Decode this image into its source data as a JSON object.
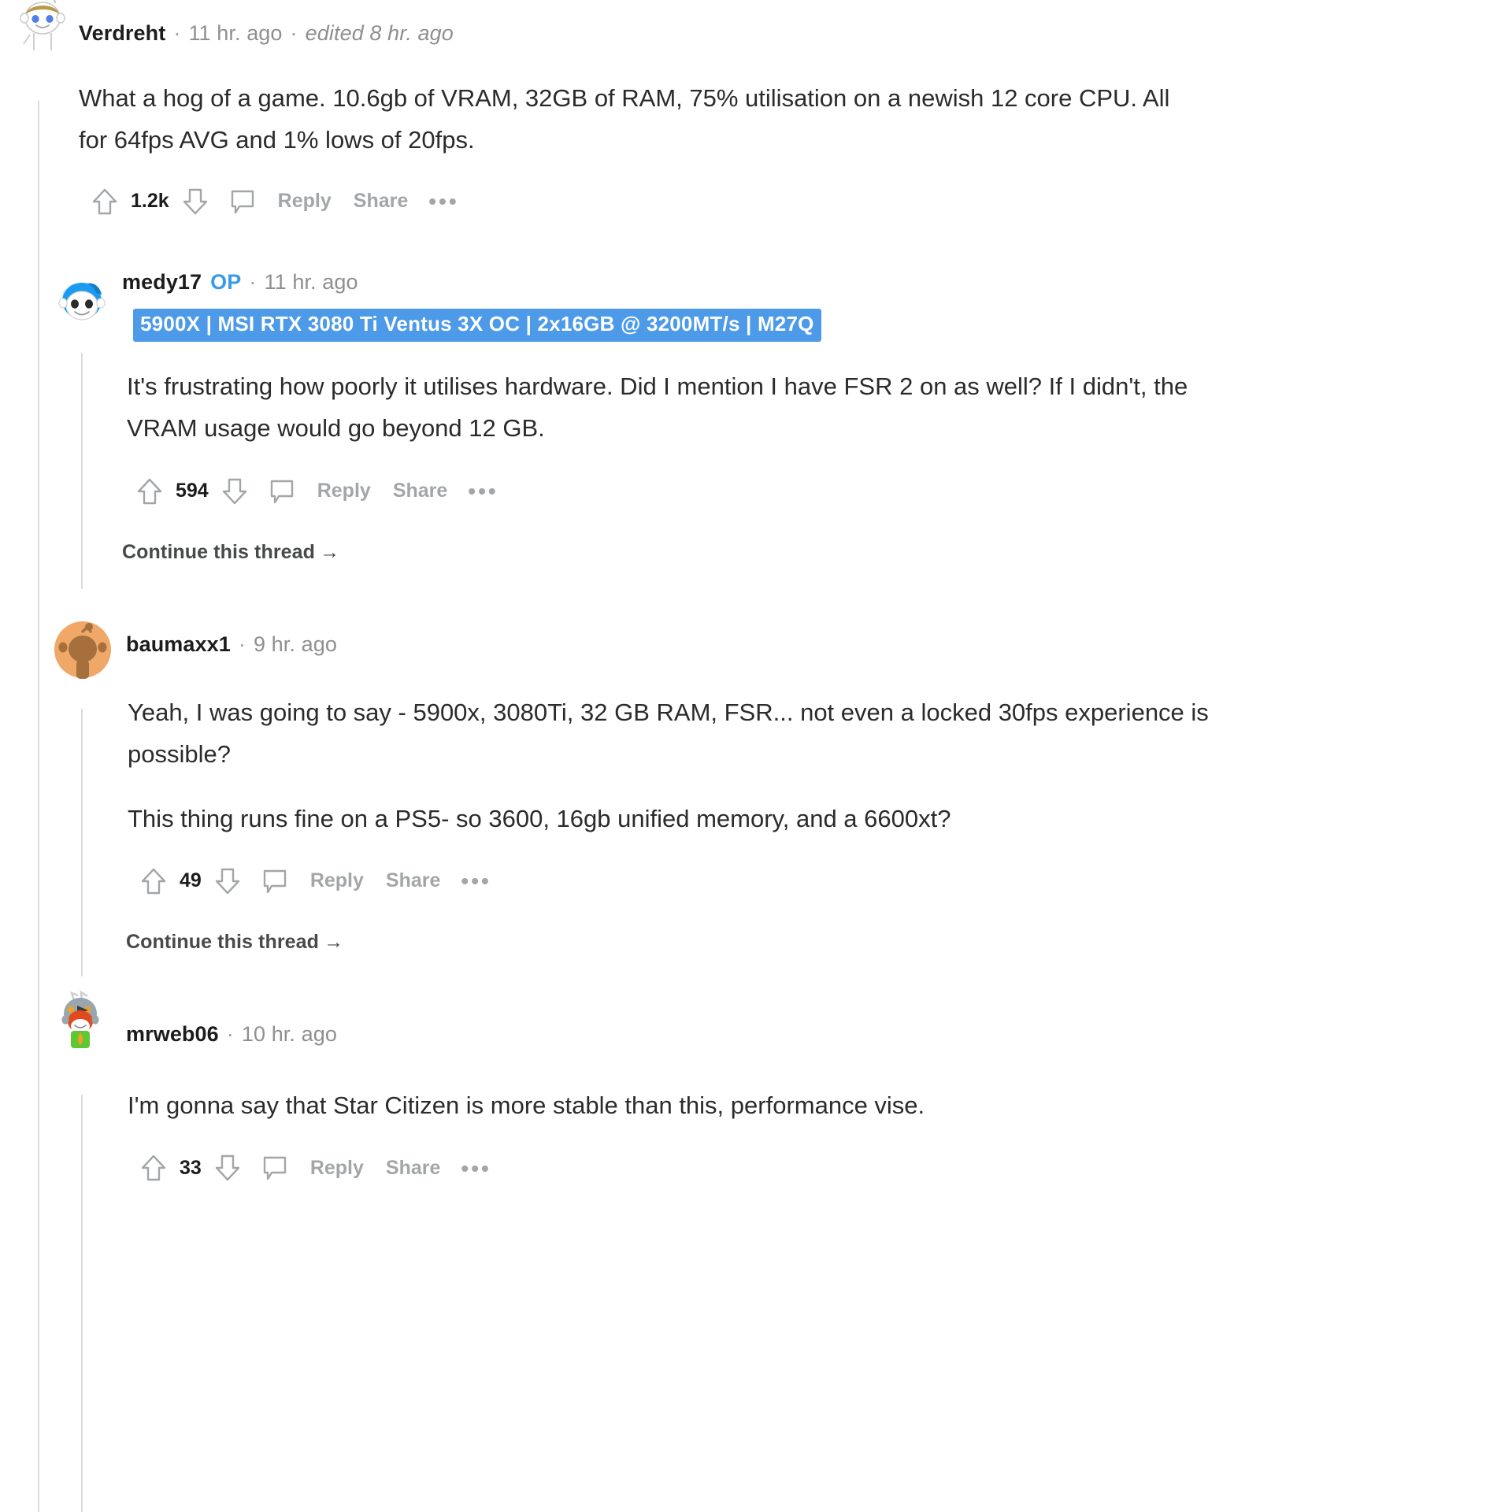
{
  "theme": {
    "accent_blue": "#4c9ae8",
    "op_blue": "#3a9ae8",
    "text": "#2b2b2b",
    "muted": "#8f8f8f",
    "action_grey": "#a3a6a8",
    "threadline": "#dcdcdc",
    "background": "#ffffff"
  },
  "comments": [
    {
      "id": "verdreht",
      "username": "Verdreht",
      "timestamp": "11 hr. ago",
      "edited": "edited 8 hr. ago",
      "separator": "·",
      "avatar_icon": "snoo-blonde-avatar",
      "paragraphs": [
        "What a hog of a game. 10.6gb of VRAM, 32GB of RAM, 75% utilisation on a newish 12 core CPU. All for 64fps AVG and 1% lows of 20fps."
      ],
      "score": "1.2k",
      "actions": {
        "upvote": "upvote-arrow",
        "downvote": "downvote-arrow",
        "comment": "comment-bubble",
        "reply": "Reply",
        "share": "Share",
        "more": "•••"
      }
    },
    {
      "id": "medy17",
      "username": "medy17",
      "op_badge": "OP",
      "timestamp": "11 hr. ago",
      "separator": "·",
      "avatar_icon": "snoo-blue-hair-avatar",
      "flair": "5900X | MSI RTX 3080 Ti Ventus 3X OC | 2x16GB @ 3200MT/s | M27Q",
      "paragraphs": [
        "It's frustrating how poorly it utilises hardware. Did I mention I have FSR 2 on as well? If I didn't, the VRAM usage would go beyond 12 GB."
      ],
      "score": "594",
      "actions": {
        "upvote": "upvote-arrow",
        "downvote": "downvote-arrow",
        "comment": "comment-bubble",
        "reply": "Reply",
        "share": "Share",
        "more": "•••"
      },
      "continue_label": "Continue this thread",
      "continue_arrow": "→"
    },
    {
      "id": "baumaxx1",
      "username": "baumaxx1",
      "timestamp": "9 hr. ago",
      "separator": "·",
      "avatar_icon": "snoo-orange-avatar",
      "paragraphs": [
        "Yeah, I was going to say - 5900x, 3080Ti, 32 GB RAM, FSR... not even a locked 30fps experience is possible?",
        "This thing runs fine on a PS5- so 3600, 16gb unified memory, and a 6600xt?"
      ],
      "score": "49",
      "actions": {
        "upvote": "upvote-arrow",
        "downvote": "downvote-arrow",
        "comment": "comment-bubble",
        "reply": "Reply",
        "share": "Share",
        "more": "•••"
      },
      "continue_label": "Continue this thread",
      "continue_arrow": "→"
    },
    {
      "id": "mrweb06",
      "username": "mrweb06",
      "timestamp": "10 hr. ago",
      "separator": "·",
      "avatar_icon": "snoo-hooded-fox-avatar",
      "paragraphs": [
        "I'm gonna say that Star Citizen is more stable than this, performance vise."
      ],
      "score": "33",
      "actions": {
        "upvote": "upvote-arrow",
        "downvote": "downvote-arrow",
        "comment": "comment-bubble",
        "reply": "Reply",
        "share": "Share",
        "more": "•••"
      }
    }
  ]
}
